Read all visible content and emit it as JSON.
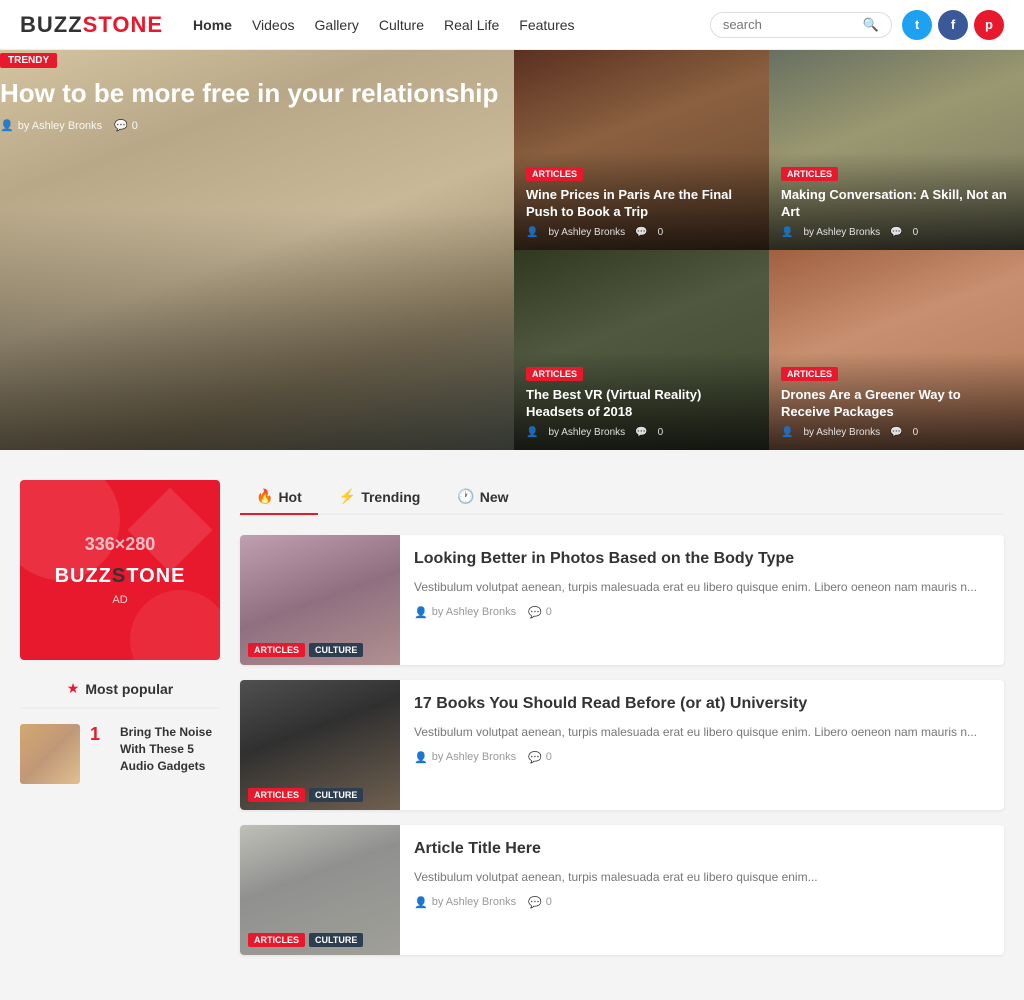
{
  "header": {
    "logo_buzz": "BUZZ",
    "logo_stone": "STONE",
    "nav": [
      {
        "label": "Home",
        "active": true
      },
      {
        "label": "Videos",
        "active": false
      },
      {
        "label": "Gallery",
        "active": false
      },
      {
        "label": "Culture",
        "active": false
      },
      {
        "label": "Real Life",
        "active": false
      },
      {
        "label": "Features",
        "active": false
      }
    ],
    "search_placeholder": "search",
    "social": [
      {
        "name": "twitter",
        "class": "social-tw",
        "icon": "t"
      },
      {
        "name": "facebook",
        "class": "social-fb",
        "icon": "f"
      },
      {
        "name": "pinterest",
        "class": "social-pt",
        "icon": "p"
      }
    ]
  },
  "hero": {
    "badge": "TRENDY",
    "title": "How to be more free in your relationship",
    "author": "by Ashley Bronks",
    "comments": "0",
    "cards": [
      {
        "badge": "ARTICLES",
        "title": "Wine Prices in Paris Are the Final Push to Book a Trip",
        "author": "by Ashley Bronks",
        "comments": "0"
      },
      {
        "badge": "ARTICLES",
        "title": "Making Conversation: A Skill, Not an Art",
        "author": "by Ashley Bronks",
        "comments": "0"
      },
      {
        "badge": "ARTICLES",
        "title": "The Best VR (Virtual Reality) Headsets of 2018",
        "author": "by Ashley Bronks",
        "comments": "0"
      },
      {
        "badge": "ARTICLES",
        "title": "Drones Are a Greener Way to Receive Packages",
        "author": "by Ashley Bronks",
        "comments": "0"
      }
    ]
  },
  "sidebar": {
    "ad": {
      "size": "336×280",
      "logo_buzz": "BUZZ",
      "logo_stone": "TONE",
      "label": "AD"
    },
    "most_popular_label": "Most popular",
    "popular_items": [
      {
        "num": "1",
        "title": "Bring The Noise With These 5 Audio Gadgets"
      }
    ]
  },
  "tabs": [
    {
      "label": "Hot",
      "icon": "🔥",
      "active": true
    },
    {
      "label": "Trending",
      "icon": "⚡",
      "active": false
    },
    {
      "label": "New",
      "icon": "🕐",
      "active": false
    }
  ],
  "articles": [
    {
      "title": "Looking Better in Photos Based on the Body Type",
      "excerpt": "Vestibulum volutpat aenean, turpis malesuada erat eu libero quisque enim. Libero oeneon nam mauris n...",
      "author": "by Ashley Bronks",
      "comments": "0",
      "badge1": "ARTICLES",
      "badge2": "CULTURE"
    },
    {
      "title": "17 Books You Should Read Before (or at) University",
      "excerpt": "Vestibulum volutpat aenean, turpis malesuada erat eu libero quisque enim. Libero oeneon nam mauris n...",
      "author": "by Ashley Bronks",
      "comments": "0",
      "badge1": "ARTICLES",
      "badge2": "CULTURE"
    },
    {
      "title": "Article Title Here",
      "excerpt": "Vestibulum volutpat aenean, turpis malesuada erat eu libero quisque enim...",
      "author": "by Ashley Bronks",
      "comments": "0",
      "badge1": "ARTICLES",
      "badge2": "CULTURE"
    }
  ]
}
